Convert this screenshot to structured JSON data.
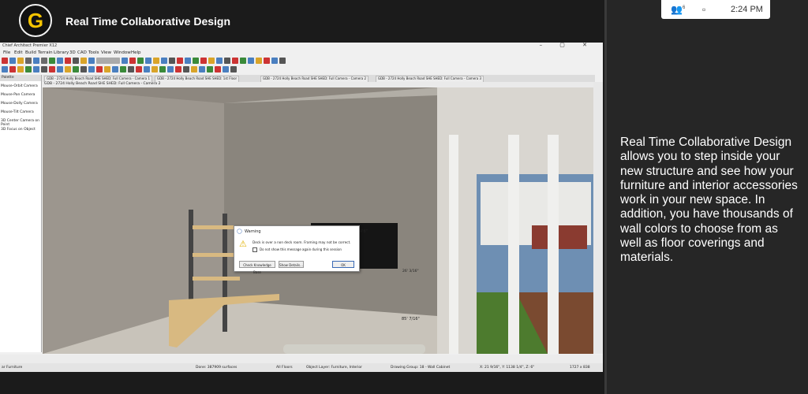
{
  "header": {
    "logo_letter": "G",
    "title": "Real Time Collaborative Design"
  },
  "taskbar": {
    "people_icon": "people-icon",
    "people_count": "6",
    "chat_icon": "chat-icon",
    "time": "2:24 PM"
  },
  "side_text": "Real Time Collaborative Design allows you to step inside your new structure and see how your furniture and interior accessories work in your new space. In addition, you have thousands of wall colors to choose from as well as floor coverings and materials.",
  "app": {
    "title": "Chief Architect Premier X12",
    "window_controls": "– ▢ ✕",
    "menus": [
      "File",
      "Edit",
      "Build",
      "Terrain",
      "Library",
      "3D",
      "CAD",
      "Tools",
      "View",
      "Window",
      "Help"
    ],
    "tabs": [
      "GDB - 2724 Holly Beach Road SHE SHED: Full Camera - Camera 1",
      "GDB - 2724 Holly Beach Road SHE SHED: 1st Floor",
      "GDB - 2724 Holly Beach Road SHE SHED: Full Camera - Camera 2",
      "GDB - 2724 Holly Beach Road SHE SHED: Full Camera - Camera 3"
    ],
    "view_title": "GDB - 2724 Holly Beach Road SHE SHED: Full Camera - Camera 2",
    "palette": {
      "title": "Palette",
      "items": [
        "Mouse-Orbit Camera",
        "Mouse-Pan Camera",
        "Mouse-Dolly Camera",
        "Mouse-Tilt Camera",
        "3D Center Camera on Point",
        "3D Focus on Object"
      ]
    },
    "dialog": {
      "title": "Warning",
      "message": "Deck is over a non deck room. Framing may not be correct.",
      "checkbox": "Do not show this message again during this session",
      "buttons": [
        "Check Knowledge Base",
        "Show Details...",
        "OK"
      ]
    },
    "dimensions": [
      "4'6\"",
      "26' 3/16\"",
      "85' 7/16\""
    ],
    "status": [
      "ar Furniture",
      "Done:  387909 surfaces",
      "All Floors",
      "Object Layer: Furniture, Interior",
      "Drawing Group: 18 - Wall Cabinet",
      "X: 21 9/16\", Y: 1138 1/4\", Z: 6\"",
      "1727 x 838"
    ]
  }
}
